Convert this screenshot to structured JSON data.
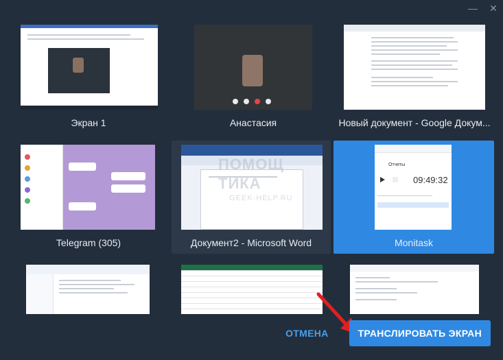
{
  "window": {
    "minimize_glyph": "—",
    "close_glyph": "✕"
  },
  "sources": [
    {
      "label": "Экран 1"
    },
    {
      "label": "Анастасия"
    },
    {
      "label": "Новый документ - Google Докум..."
    },
    {
      "label": "Telegram (305)"
    },
    {
      "label": "Документ2 - Microsoft Word"
    },
    {
      "label": "Monitask",
      "selected": true
    },
    {
      "label": ""
    },
    {
      "label": ""
    },
    {
      "label": ""
    }
  ],
  "monitask_preview": {
    "timer": "09:49:32",
    "tab": "Отчеты"
  },
  "watermark": {
    "line1": "ПОМОЩ",
    "line2": "ТИКА",
    "line3": "GEEK-HELP.RU"
  },
  "footer": {
    "cancel_label": "ОТМЕНА",
    "share_label": "ТРАНСЛИРОВАТЬ ЭКРАН"
  },
  "colors": {
    "accent": "#2f89e3",
    "background": "#232e3c",
    "arrow": "#e02020"
  }
}
